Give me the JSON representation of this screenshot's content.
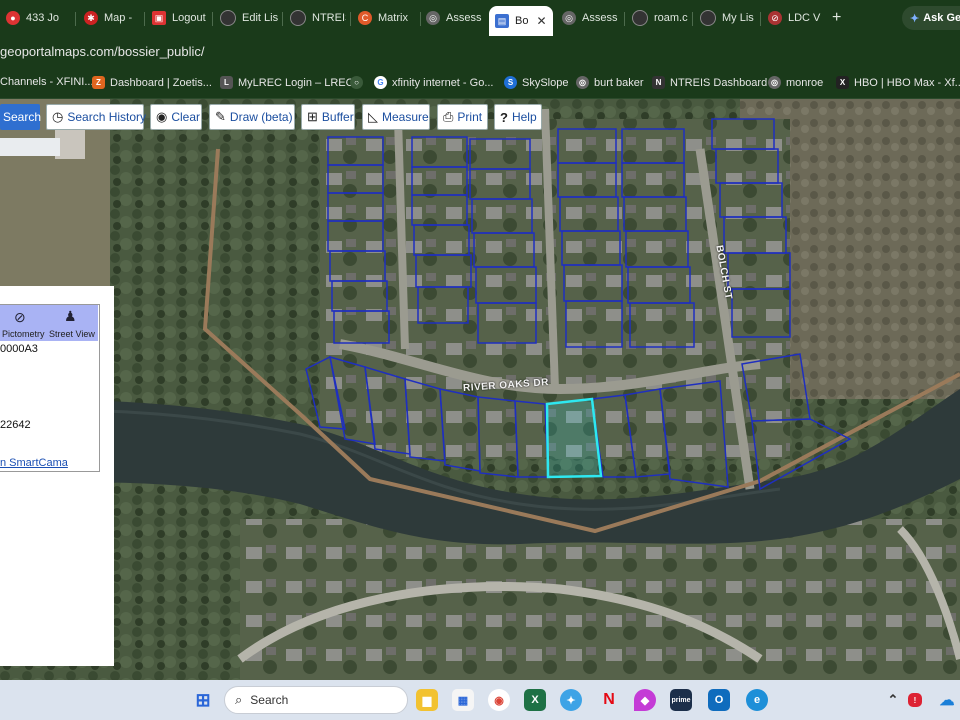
{
  "browser": {
    "tabs": [
      {
        "label": "433 Jo",
        "color": "#d33"
      },
      {
        "label": "Map -",
        "color": "#c22"
      },
      {
        "label": "Logout",
        "color": "#d33"
      },
      {
        "label": "Edit Lis",
        "color": "#333"
      },
      {
        "label": "NTREIS",
        "color": "#333"
      },
      {
        "label": "Matrix",
        "color": "#e05a2a"
      },
      {
        "label": "Assess",
        "color": "#666"
      },
      {
        "label": "Bo",
        "color": "#3b6fd0",
        "active": true
      },
      {
        "label": "Assess",
        "color": "#666"
      },
      {
        "label": "roam.c",
        "color": "#333"
      },
      {
        "label": "My Lis",
        "color": "#333"
      },
      {
        "label": "LDC V",
        "color": "#a33"
      }
    ],
    "new_tab": "+",
    "ask_button": "Ask Ge",
    "url": "geoportalmaps.com/bossier_public/",
    "bookmarks": [
      {
        "label": "Channels - XFINI...",
        "color": "#333"
      },
      {
        "label": "Dashboard | Zoetis...",
        "color": "#e0661f"
      },
      {
        "label": "MyLREC Login – LREC",
        "color": "#555"
      },
      {
        "label": "",
        "color": "#4a7"
      },
      {
        "label": "xfinity internet - Go...",
        "color": "#4285f4"
      },
      {
        "label": "SkySlope",
        "color": "#1f6fd6"
      },
      {
        "label": "burt baker",
        "color": "#666"
      },
      {
        "label": "NTREIS Dashboard",
        "color": "#333"
      },
      {
        "label": "monroe",
        "color": "#666"
      },
      {
        "label": "HBO | HBO Max - Xf...",
        "color": "#222"
      }
    ]
  },
  "toolbar": {
    "search": "Search",
    "history": "Search History",
    "clear": "Clear",
    "draw": "Draw (beta)",
    "buffer": "Buffer",
    "measure": "Measure",
    "print": "Print",
    "help": "Help"
  },
  "panel": {
    "pictometry": "Pictometry",
    "street_view": "Street View",
    "parcel_id": "0000A3",
    "number": "22642",
    "link": "n SmartCama"
  },
  "map": {
    "roads": {
      "river_oaks": "RIVER OAKS DR",
      "bolch": "BOLCH ST"
    },
    "colors": {
      "parcel_line": "#1f2fbf",
      "selected_parcel": "#2ee8f0",
      "boundary": "#9a7a5a"
    }
  },
  "taskbar": {
    "search": "Search"
  }
}
